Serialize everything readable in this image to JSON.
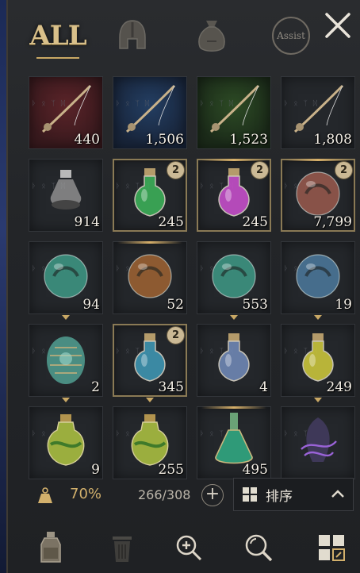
{
  "tabs": {
    "all_label": "ALL",
    "helmet_icon": "helmet-icon",
    "bag_icon": "bag-icon",
    "assist_label": "Assist"
  },
  "close_icon": "close-icon",
  "items": [
    {
      "icon": "fishing-rod-icon",
      "bg": "red",
      "count": "440"
    },
    {
      "icon": "fishing-rod-icon",
      "bg": "blue",
      "count": "1,506"
    },
    {
      "icon": "fishing-rod-icon",
      "bg": "green",
      "count": "1,523"
    },
    {
      "icon": "fishing-rod-icon",
      "bg": "dark",
      "count": "1,808"
    },
    {
      "icon": "empty-flask-icon",
      "bg": "dark",
      "count": "914"
    },
    {
      "icon": "green-potion-icon",
      "bg": "dark",
      "count": "245",
      "badge": "2"
    },
    {
      "icon": "pink-potion-icon",
      "bg": "dark",
      "count": "245",
      "badge": "2"
    },
    {
      "icon": "crimson-orb-icon",
      "bg": "dark",
      "count": "7,799",
      "badge": "2"
    },
    {
      "icon": "teal-orb-icon",
      "bg": "dark",
      "count": "94"
    },
    {
      "icon": "bronze-orb-icon",
      "bg": "dark",
      "count": "52"
    },
    {
      "icon": "teal-orb-icon",
      "bg": "dark",
      "count": "553"
    },
    {
      "icon": "blue-orb-icon",
      "bg": "dark",
      "count": "19"
    },
    {
      "icon": "dragon-egg-icon",
      "bg": "dark",
      "count": "2"
    },
    {
      "icon": "blue-vial-icon",
      "bg": "dark",
      "count": "345",
      "badge": "2"
    },
    {
      "icon": "clear-potion-icon",
      "bg": "dark",
      "count": "4"
    },
    {
      "icon": "yellow-potion-icon",
      "bg": "dark",
      "count": "249"
    },
    {
      "icon": "herb-jug-icon",
      "bg": "dark",
      "count": "9"
    },
    {
      "icon": "herb-jug-icon",
      "bg": "dark",
      "count": "255"
    },
    {
      "icon": "green-flask-icon",
      "bg": "dark",
      "count": "495"
    },
    {
      "icon": "void-crystal-icon",
      "bg": "dark",
      "count": ""
    }
  ],
  "status": {
    "weight_icon": "weight-icon",
    "weight_percent": "70%",
    "capacity": "266/308",
    "sort_label": "排序"
  },
  "toolbar": {
    "potion_icon": "potion-icon",
    "trash_icon": "trash-icon",
    "zoom_in_icon": "zoom-in-icon",
    "search_icon": "search-icon",
    "grid_icon": "grid-icon"
  },
  "colors": {
    "gold": "#d2b06c",
    "panel": "#232528",
    "text": "#f4efe6"
  }
}
